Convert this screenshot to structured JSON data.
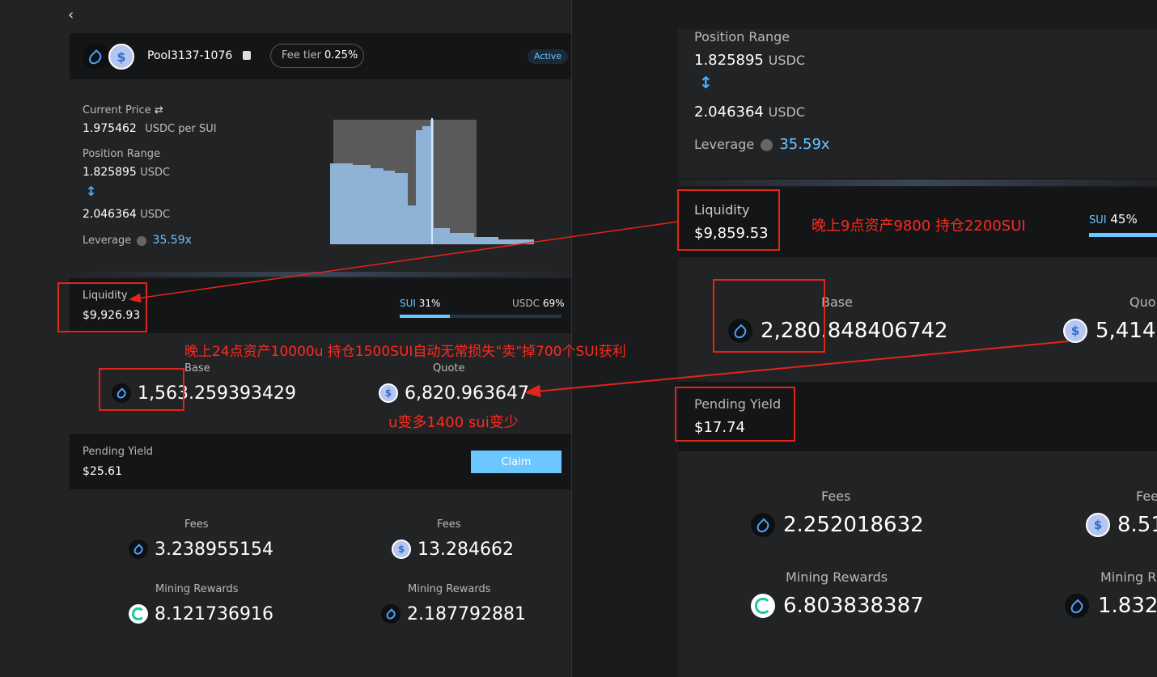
{
  "left": {
    "pool_name": "Pool3137-1076",
    "fee_tier_label": "Fee tier",
    "fee_tier_value": "0.25%",
    "status": "Active",
    "current_price_label": "Current Price",
    "current_price_value": "1.975462",
    "current_price_unit": "USDC per SUI",
    "position_range_label": "Position Range",
    "range_low": "1.825895",
    "range_high": "2.046364",
    "range_unit": "USDC",
    "leverage_label": "Leverage",
    "leverage_value": "35.59x",
    "liquidity_label": "Liquidity",
    "liquidity_value": "$9,926.93",
    "sui_ratio_label": "SUI",
    "sui_ratio": "31%",
    "usdc_ratio_label": "USDC",
    "usdc_ratio": "69%",
    "sui_fraction": 0.31,
    "base_label": "Base",
    "base_value": "1,563.259393429",
    "quote_label": "Quote",
    "quote_value": "6,820.963647",
    "pending_yield_label": "Pending Yield",
    "pending_yield_value": "$25.61",
    "claim_label": "Claim",
    "fees_label": "Fees",
    "fees_sui": "3.238955154",
    "fees_usdc": "13.284662",
    "mining_label": "Mining Rewards",
    "mining_cetus": "8.121736916",
    "mining_sui": "2.187792881"
  },
  "right": {
    "position_range_label": "Position Range",
    "range_low": "1.825895",
    "range_high": "2.046364",
    "range_unit": "USDC",
    "leverage_label": "Leverage",
    "leverage_value": "35.59x",
    "liquidity_label": "Liquidity",
    "liquidity_value": "$9,859.53",
    "sui_ratio_label": "SUI",
    "sui_ratio": "45%",
    "base_label": "Base",
    "base_value": "2,280.848406742",
    "quote_label": "Quo",
    "quote_value": "5,414.",
    "pending_yield_label": "Pending Yield",
    "pending_yield_value": "$17.74",
    "fees_label": "Fees",
    "fees_sui": "2.252018632",
    "fees_usdc": "8.51",
    "mining_label": "Mining Rewards",
    "mining_label_cut": "Mining R",
    "mining_cetus": "6.803838387",
    "mining_sui": "1.832"
  },
  "annotations": {
    "note_9pm": "晚上9点资产9800 持仓2200SUI",
    "note_24": "晚上24点资产10000u 持仓1500SUI自动无常损失\"卖\"掉700个SUI获利",
    "note_u": "u变多1400 sui变少"
  },
  "colors": {
    "accent_blue": "#6cc6ff",
    "annotation_red": "#e3241b",
    "histogram_blue": "#8fb3d6"
  },
  "icons": [
    "back-chevron-icon",
    "sui-token-icon",
    "usdc-token-icon",
    "copy-icon",
    "swap-icon",
    "range-arrows-icon",
    "info-icon",
    "cetus-token-icon"
  ]
}
